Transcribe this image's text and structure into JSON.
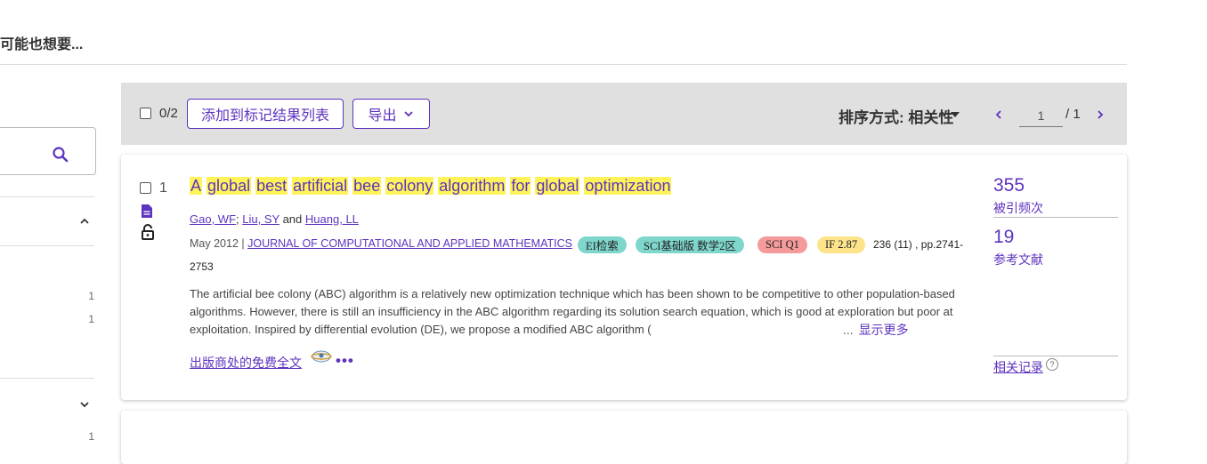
{
  "page": {
    "heading": "您可能也想要..."
  },
  "sidebar": {
    "counts": [
      "1",
      "1",
      "1"
    ]
  },
  "toolbar": {
    "selected_count": "0/2",
    "add_to_marked_label": "添加到标记结果列表",
    "export_label": "导出",
    "sort_label": "排序方式: 相关性",
    "page_current": "1",
    "page_total": "/ 1"
  },
  "records": [
    {
      "number": "1",
      "title_words": [
        "A",
        "global",
        "best",
        "artificial",
        "bee",
        "colony",
        "algorithm",
        "for",
        "global",
        "optimization"
      ],
      "authors": [
        "Gao, WF",
        "Liu, SY",
        "Huang, LL"
      ],
      "author_sep": ";",
      "author_and": "and",
      "date": "May 2012 |",
      "journal": "JOURNAL OF COMPUTATIONAL AND APPLIED MATHEMATICS",
      "badges": [
        {
          "label": "EI检索",
          "color": "#7fd6cc"
        },
        {
          "label": "SCI基础版 数学2区",
          "color": "#7fd6cc"
        },
        {
          "label": "SCI Q1",
          "color": "#f59a9a"
        },
        {
          "label": "IF 2.87",
          "color": "#fde48a"
        }
      ],
      "volume": "236 (11) , pp.2741-",
      "volume_cont": "2753",
      "abstract": "The artificial bee colony (ABC) algorithm is a relatively new optimization technique which has been shown to be competitive to other population-based algorithms. However, there is still an insufficiency in the ABC algorithm regarding its solution search equation, which is good at exploration but poor at exploitation. Inspired by differential evolution (DE), we propose a modified ABC algorithm (",
      "ellipsis": "...",
      "show_more": "显示更多",
      "full_text": "出版商处的免费全文",
      "more": "•••",
      "citations": "355",
      "citations_label": "被引频次",
      "references": "19",
      "references_label": "参考文献",
      "related": "相关记录",
      "help": "?"
    }
  ],
  "colors": {
    "accent": "#5e33bf",
    "highlight": "#fff35a",
    "toolbar_bg": "#e0e0e0"
  },
  "icons": [
    "search-icon",
    "chevron-up-icon",
    "chevron-down-icon",
    "caret-down-icon",
    "chevron-left-icon",
    "chevron-right-icon",
    "document-icon",
    "unlock-icon",
    "full-text-viewer-icon",
    "help-icon"
  ]
}
